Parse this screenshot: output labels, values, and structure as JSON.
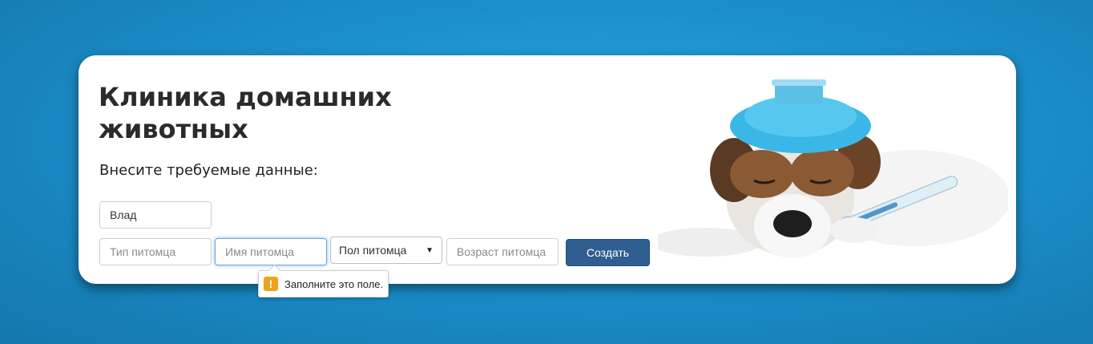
{
  "header": {
    "title": "Клиника домашних животных",
    "subtitle": "Внесите требуемые данные:"
  },
  "form": {
    "owner": {
      "value": "Влад"
    },
    "pet_type": {
      "placeholder": "Тип питомца"
    },
    "pet_name": {
      "placeholder": "Имя питомца"
    },
    "pet_sex": {
      "selected": "Пол питомца"
    },
    "pet_age": {
      "placeholder": "Возраст питомца"
    },
    "submit_label": "Создать"
  },
  "validation": {
    "message": "Заполните это поле."
  },
  "image": {
    "icon": "sick-dog-with-ice-pack-and-thermometer"
  }
}
